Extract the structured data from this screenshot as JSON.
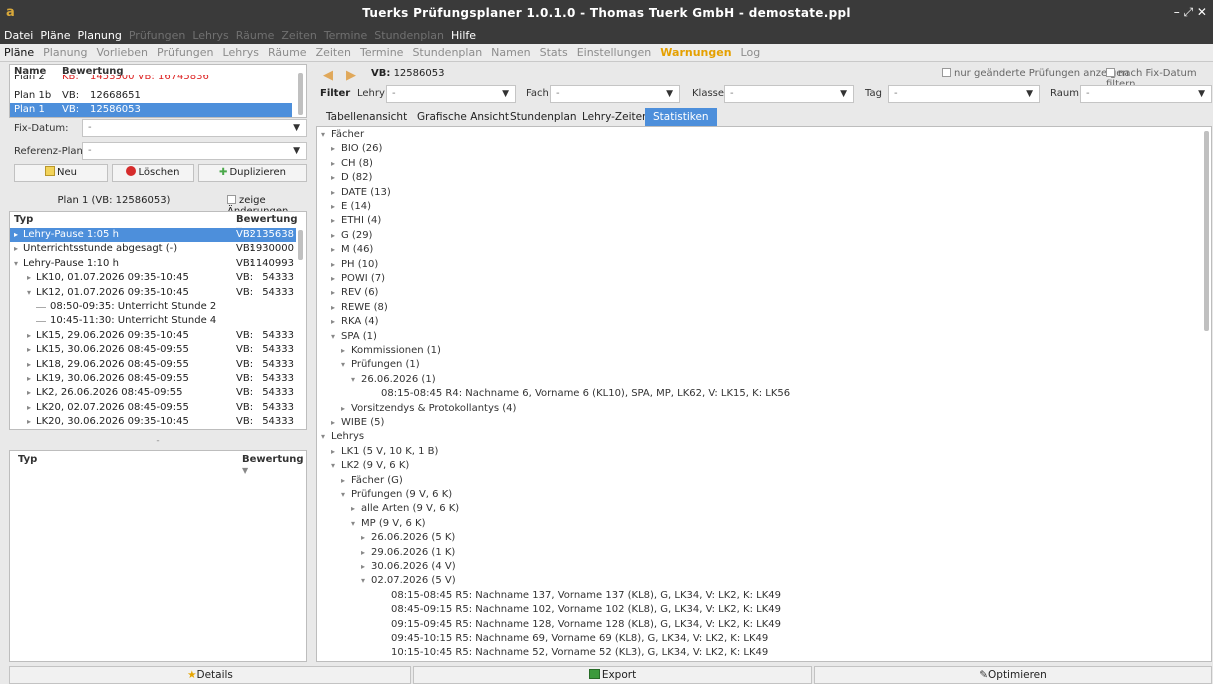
{
  "window": {
    "title": "Tuerks Prüfungsplaner 1.0.1.0 - Thomas Tuerk GmbH - demostate.ppl",
    "controls": "– ⤢ ✕"
  },
  "menubar": [
    {
      "label": "Datei",
      "enabled": true
    },
    {
      "label": "Pläne",
      "enabled": true
    },
    {
      "label": "Planung",
      "enabled": true
    },
    {
      "label": "Prüfungen",
      "enabled": false
    },
    {
      "label": "Lehrys",
      "enabled": false
    },
    {
      "label": "Räume",
      "enabled": false
    },
    {
      "label": "Zeiten",
      "enabled": false
    },
    {
      "label": "Termine",
      "enabled": false
    },
    {
      "label": "Stundenplan",
      "enabled": false
    },
    {
      "label": "Hilfe",
      "enabled": true
    }
  ],
  "maintabs": [
    {
      "label": "Pläne",
      "state": "active"
    },
    {
      "label": "Planung",
      "state": ""
    },
    {
      "label": "Vorlieben",
      "state": ""
    },
    {
      "label": "Prüfungen",
      "state": ""
    },
    {
      "label": "Lehrys",
      "state": ""
    },
    {
      "label": "Räume",
      "state": ""
    },
    {
      "label": "Zeiten",
      "state": ""
    },
    {
      "label": "Termine",
      "state": ""
    },
    {
      "label": "Stundenplan",
      "state": ""
    },
    {
      "label": "Namen",
      "state": ""
    },
    {
      "label": "Stats",
      "state": ""
    },
    {
      "label": "Einstellungen",
      "state": ""
    },
    {
      "label": "Warnungen",
      "state": "warn"
    },
    {
      "label": "Log",
      "state": ""
    }
  ],
  "plans": {
    "col_name": "Name",
    "col_rating": "Bewertung",
    "rows": [
      {
        "name": "Plan 2",
        "kind": "KB:",
        "value": "1453500 VB:   16745836",
        "selected": false,
        "red": true
      },
      {
        "name": "Plan 1b",
        "kind": "VB:",
        "value": "12668651",
        "selected": false,
        "red": false
      },
      {
        "name": "Plan 1",
        "kind": "VB:",
        "value": "12586053",
        "selected": true,
        "red": false
      }
    ],
    "fixdatum_label": "Fix-Datum:",
    "fixdatum_value": "-",
    "referenz_label": "Referenz-Plan:",
    "referenz_value": "-",
    "btn_neu": "Neu",
    "btn_loeschen": "Löschen",
    "btn_duplizieren": "Duplizieren"
  },
  "plandetail": {
    "title": "Plan 1 (VB: 12586053)",
    "show_changes": "zeige Änderungen",
    "col_typ": "Typ",
    "col_rating": "Bewertung",
    "rows": [
      {
        "indent": 0,
        "tri": "▸",
        "text": "Lehry-Pause 1:05 h",
        "kind": "VB:",
        "value": "2135638",
        "selected": true
      },
      {
        "indent": 0,
        "tri": "▸",
        "text": "Unterrichtsstunde abgesagt (-)",
        "kind": "VB:",
        "value": "1930000",
        "selected": false
      },
      {
        "indent": 0,
        "tri": "▾",
        "text": "Lehry-Pause 1:10 h",
        "kind": "VB:",
        "value": "1140993",
        "selected": false
      },
      {
        "indent": 1,
        "tri": "▸",
        "text": "LK10, 01.07.2026 09:35-10:45",
        "kind": "VB:",
        "value": "54333",
        "selected": false
      },
      {
        "indent": 1,
        "tri": "▾",
        "text": "LK12, 01.07.2026 09:35-10:45",
        "kind": "VB:",
        "value": "54333",
        "selected": false
      },
      {
        "indent": 2,
        "tri": "",
        "text": "08:50-09:35: Unterricht Stunde 2",
        "kind": "",
        "value": "",
        "selected": false
      },
      {
        "indent": 2,
        "tri": "",
        "text": "10:45-11:30: Unterricht Stunde 4",
        "kind": "",
        "value": "",
        "selected": false
      },
      {
        "indent": 1,
        "tri": "▸",
        "text": "LK15, 29.06.2026 09:35-10:45",
        "kind": "VB:",
        "value": "54333",
        "selected": false
      },
      {
        "indent": 1,
        "tri": "▸",
        "text": "LK15, 30.06.2026 08:45-09:55",
        "kind": "VB:",
        "value": "54333",
        "selected": false
      },
      {
        "indent": 1,
        "tri": "▸",
        "text": "LK18, 29.06.2026 08:45-09:55",
        "kind": "VB:",
        "value": "54333",
        "selected": false
      },
      {
        "indent": 1,
        "tri": "▸",
        "text": "LK19, 30.06.2026 08:45-09:55",
        "kind": "VB:",
        "value": "54333",
        "selected": false
      },
      {
        "indent": 1,
        "tri": "▸",
        "text": "LK2, 26.06.2026 08:45-09:55",
        "kind": "VB:",
        "value": "54333",
        "selected": false
      },
      {
        "indent": 1,
        "tri": "▸",
        "text": "LK20, 02.07.2026 08:45-09:55",
        "kind": "VB:",
        "value": "54333",
        "selected": false
      },
      {
        "indent": 1,
        "tri": "▸",
        "text": "LK20, 30.06.2026 09:35-10:45",
        "kind": "VB:",
        "value": "54333",
        "selected": false
      }
    ],
    "separator": "-",
    "lower_col_typ": "Typ",
    "lower_col_rating": "Bewertung"
  },
  "right": {
    "vb_label": "VB:",
    "vb_value": "12586053",
    "only_changed": "nur geänderte Prüfungen anzeigen",
    "fix_filter": "nach Fix-Datum filtern",
    "filter_label": "Filter",
    "filters": [
      {
        "label": "Lehry",
        "value": "-"
      },
      {
        "label": "Fach",
        "value": "-"
      },
      {
        "label": "Klasse",
        "value": "-"
      },
      {
        "label": "Tag",
        "value": "-"
      },
      {
        "label": "Raum",
        "value": "-"
      }
    ],
    "subtabs": [
      {
        "label": "Tabellenansicht",
        "active": false
      },
      {
        "label": "Grafische Ansicht",
        "active": false
      },
      {
        "label": "Stundenplan",
        "active": false
      },
      {
        "label": "Lehry-Zeiten",
        "active": false
      },
      {
        "label": "Statistiken",
        "active": true
      }
    ],
    "tree": [
      {
        "indent": 0,
        "tri": "▾",
        "text": "Fächer"
      },
      {
        "indent": 1,
        "tri": "▸",
        "text": "BIO (26)"
      },
      {
        "indent": 1,
        "tri": "▸",
        "text": "CH (8)"
      },
      {
        "indent": 1,
        "tri": "▸",
        "text": "D (82)"
      },
      {
        "indent": 1,
        "tri": "▸",
        "text": "DATE (13)"
      },
      {
        "indent": 1,
        "tri": "▸",
        "text": "E (14)"
      },
      {
        "indent": 1,
        "tri": "▸",
        "text": "ETHI (4)"
      },
      {
        "indent": 1,
        "tri": "▸",
        "text": "G (29)"
      },
      {
        "indent": 1,
        "tri": "▸",
        "text": "M (46)"
      },
      {
        "indent": 1,
        "tri": "▸",
        "text": "PH (10)"
      },
      {
        "indent": 1,
        "tri": "▸",
        "text": "POWI (7)"
      },
      {
        "indent": 1,
        "tri": "▸",
        "text": "REV (6)"
      },
      {
        "indent": 1,
        "tri": "▸",
        "text": "REWE (8)"
      },
      {
        "indent": 1,
        "tri": "▸",
        "text": "RKA (4)"
      },
      {
        "indent": 1,
        "tri": "▾",
        "text": "SPA (1)"
      },
      {
        "indent": 2,
        "tri": "▸",
        "text": "Kommissionen (1)"
      },
      {
        "indent": 2,
        "tri": "▾",
        "text": "Prüfungen (1)"
      },
      {
        "indent": 3,
        "tri": "▾",
        "text": "26.06.2026 (1)"
      },
      {
        "indent": 4,
        "tri": "",
        "text": "08:15-08:45 R4: Nachname 6, Vorname 6 (KL10), SPA, MP, LK62, V: LK15, K: LK56"
      },
      {
        "indent": 2,
        "tri": "▸",
        "text": "Vorsitzendys & Protokollantys (4)"
      },
      {
        "indent": 1,
        "tri": "▸",
        "text": "WIBE (5)"
      },
      {
        "indent": 0,
        "tri": "▾",
        "text": "Lehrys"
      },
      {
        "indent": 1,
        "tri": "▸",
        "text": "LK1 (5 V, 10 K, 1 B)"
      },
      {
        "indent": 1,
        "tri": "▾",
        "text": "LK2 (9 V, 6 K)"
      },
      {
        "indent": 2,
        "tri": "▸",
        "text": "Fächer (G)"
      },
      {
        "indent": 2,
        "tri": "▾",
        "text": "Prüfungen (9 V, 6 K)"
      },
      {
        "indent": 3,
        "tri": "▸",
        "text": "alle Arten (9 V, 6 K)"
      },
      {
        "indent": 3,
        "tri": "▾",
        "text": "MP (9 V, 6 K)"
      },
      {
        "indent": 4,
        "tri": "▸",
        "text": "26.06.2026 (5 K)"
      },
      {
        "indent": 4,
        "tri": "▸",
        "text": "29.06.2026 (1 K)"
      },
      {
        "indent": 4,
        "tri": "▸",
        "text": "30.06.2026 (4 V)"
      },
      {
        "indent": 4,
        "tri": "▾",
        "text": "02.07.2026 (5 V)"
      },
      {
        "indent": 5,
        "tri": "",
        "text": "08:15-08:45 R5: Nachname 137, Vorname 137 (KL8), G, LK34, V: LK2, K: LK49"
      },
      {
        "indent": 5,
        "tri": "",
        "text": "08:45-09:15 R5: Nachname 102, Vorname 102 (KL8), G, LK34, V: LK2, K: LK49"
      },
      {
        "indent": 5,
        "tri": "",
        "text": "09:15-09:45 R5: Nachname 128, Vorname 128 (KL8), G, LK34, V: LK2, K: LK49"
      },
      {
        "indent": 5,
        "tri": "",
        "text": "09:45-10:15 R5: Nachname 69, Vorname 69 (KL8), G, LK34, V: LK2, K: LK49"
      },
      {
        "indent": 5,
        "tri": "",
        "text": "10:15-10:45 R5: Nachname 52, Vorname 52 (KL3), G, LK34, V: LK2, K: LK49"
      }
    ]
  },
  "bottom": {
    "details": "Details",
    "export": "Export",
    "optimieren": "Optimieren"
  }
}
